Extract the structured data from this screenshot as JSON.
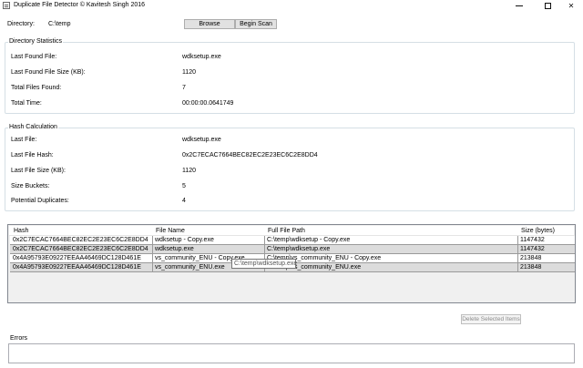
{
  "window": {
    "title": "Duplicate File Detector © Kavitesh Singh 2016",
    "minimize_icon": "minimize-icon",
    "maximize_icon": "maximize-icon",
    "close_icon": "close-icon",
    "close_glyph": "✕"
  },
  "directory": {
    "label": "Directory:",
    "value": "C:\\temp",
    "browse_label": "Browse",
    "scan_label": "Begin Scan"
  },
  "stats": {
    "title": "Directory Statistics",
    "rows": [
      {
        "label": "Last Found File:",
        "value": "wdksetup.exe"
      },
      {
        "label": "Last Found File Size (KB):",
        "value": "1120"
      },
      {
        "label": "Total Files Found:",
        "value": "7"
      },
      {
        "label": "Total Time:",
        "value": "00:00:00.0641749"
      }
    ]
  },
  "hash": {
    "title": "Hash Calculation",
    "rows": [
      {
        "label": "Last File:",
        "value": "wdksetup.exe"
      },
      {
        "label": "Last File Hash:",
        "value": "0x2C7ECAC7664BEC82EC2E23EC6C2E8DD4"
      },
      {
        "label": "Last File Size (KB):",
        "value": "1120"
      },
      {
        "label": "Size Buckets:",
        "value": "5"
      },
      {
        "label": "Potential Duplicates:",
        "value": "4"
      }
    ]
  },
  "grid": {
    "columns": [
      "Hash",
      "File Name",
      "Full File Path",
      "Size (bytes)"
    ],
    "rows": [
      [
        "0x2C7ECAC7664BEC82EC2E23EC6C2E8DD4",
        "wdksetup - Copy.exe",
        "C:\\temp\\wdksetup - Copy.exe",
        "1147432"
      ],
      [
        "0x2C7ECAC7664BEC82EC2E23EC6C2E8DD4",
        "wdksetup.exe",
        "C:\\temp\\wdksetup.exe",
        "1147432"
      ],
      [
        "0x4A95793E09227EEAA46469DC128D461E",
        "vs_community_ENU - Copy.exe",
        "C:\\temp\\vs_community_ENU - Copy.exe",
        "213848"
      ],
      [
        "0x4A95793E09227EEAA46469DC128D461E",
        "vs_community_ENU.exe",
        "C:\\temp\\vs_community_ENU.exe",
        "213848"
      ]
    ],
    "tooltip": "C:\\temp\\wdksetup.exe"
  },
  "actions": {
    "delete_label": "Delete Selected Items"
  },
  "errors": {
    "label": "Errors",
    "value": ""
  }
}
